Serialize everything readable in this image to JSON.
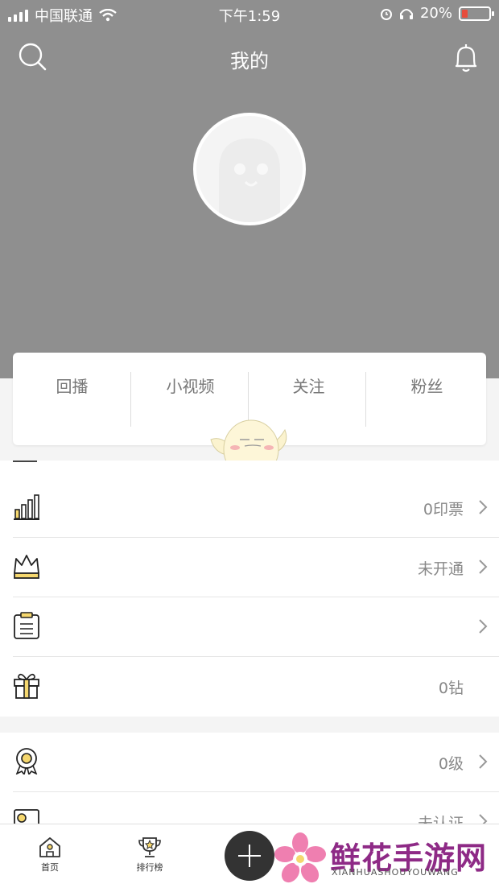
{
  "status_bar": {
    "carrier": "中国联通",
    "time": "下午1:59",
    "battery": "20%"
  },
  "header": {
    "title": "我的"
  },
  "stats_tabs": [
    "回播",
    "小视频",
    "关注",
    "粉丝"
  ],
  "menu_rows": [
    {
      "icon": "bar-chart-icon",
      "value": "0印票"
    },
    {
      "icon": "crown-icon",
      "value": "未开通"
    },
    {
      "icon": "clipboard-icon",
      "value": ""
    },
    {
      "icon": "gift-icon",
      "value": "0钻"
    },
    {
      "icon": "medal-icon",
      "value": "0级"
    },
    {
      "icon": "id-card-icon",
      "value": "未认证"
    }
  ],
  "bottom_nav": {
    "home": "首页",
    "ranking": "排行榜"
  },
  "watermark": {
    "cn": "鲜花手游网",
    "en": "XIANHUASHOUYOUWANG"
  },
  "colors": {
    "header_bg": "#8f8f8f",
    "accent_yellow": "#f5d76e",
    "plus_button": "#333333"
  }
}
